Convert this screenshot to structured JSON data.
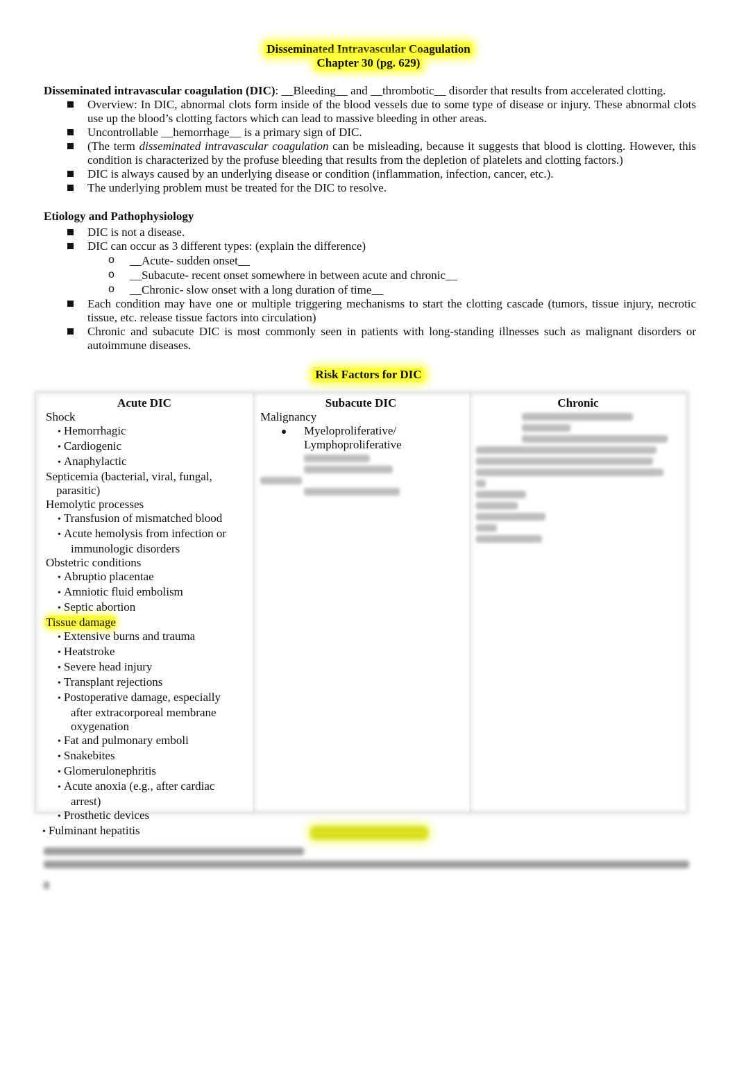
{
  "header": {
    "title": "Disseminated Intravascular Coagulation",
    "subtitle": "Chapter 30 (pg. 629)",
    "highlight_color": "#ffff3a"
  },
  "intro": {
    "term": "Disseminated intravascular coagulation (DIC)",
    "definition": ": __Bleeding__ and __thrombotic__ disorder that results from accelerated clotting.",
    "bullets": [
      {
        "text": "Overview: In DIC, abnormal clots form inside of the blood vessels due to some type of disease or injury. These abnormal clots use up the blood’s clotting factors which can lead to massive bleeding in other areas."
      },
      {
        "text": "Uncontrollable __hemorrhage__ is a primary sign of DIC."
      },
      {
        "pre": "(The term ",
        "em": "disseminated intravascular coagulation",
        "post": " can be misleading, because it suggests that blood is clotting. However, this condition is characterized by the profuse bleeding that results from the depletion of platelets and clotting factors.)"
      },
      {
        "text": "DIC is always caused by an underlying disease or condition (inflammation, infection, cancer, etc.)."
      },
      {
        "text": "The underlying problem must be treated for the DIC to resolve."
      }
    ]
  },
  "etiology": {
    "heading": "Etiology and Pathophysiology",
    "bullets": [
      "DIC is not a disease.",
      "DIC can occur as 3 different types: (explain the difference)"
    ],
    "types": [
      "__Acute- sudden onset__",
      "__Subacute- recent onset somewhere in between acute and chronic__",
      "__Chronic- slow onset with a long duration of time__"
    ],
    "bullets_after": [
      "Each condition may have one or multiple triggering mechanisms to start the clotting cascade (tumors, tissue injury, necrotic tissue, etc. release tissue factors into circulation)",
      "Chronic and subacute DIC is most commonly seen in patients with long-standing illnesses such as malignant disorders or autoimmune diseases."
    ]
  },
  "risk_table": {
    "title": "Risk Factors for DIC",
    "headers": [
      "Acute DIC",
      "Subacute DIC",
      "Chronic"
    ],
    "acute": {
      "shock": {
        "label": "Shock",
        "items": [
          "Hemorrhagic",
          "Cardiogenic",
          "Anaphylactic"
        ]
      },
      "septicemia": {
        "line1": "Septicemia (bacterial, viral, fungal,",
        "line2": "parasitic)"
      },
      "hemolytic": {
        "label": "Hemolytic processes",
        "items": [
          "Transfusion of mismatched blood",
          "Acute hemolysis from infection or"
        ],
        "continuation": "immunologic disorders"
      },
      "obstetric": {
        "label": "Obstetric conditions",
        "items": [
          "Abruptio placentae",
          "Amniotic fluid embolism",
          "Septic abortion"
        ]
      },
      "tissue": {
        "label": "Tissue damage",
        "items": [
          "Extensive burns and trauma",
          "Heatstroke",
          "Severe head injury",
          "Transplant rejections",
          "Postoperative damage, especially"
        ],
        "cont1": "after extracorporeal membrane",
        "cont2": "oxygenation",
        "items2": [
          "Fat and pulmonary emboli",
          "Snakebites",
          "Glomerulonephritis",
          "Acute anoxia (e.g., after cardiac"
        ],
        "cont3": "arrest)",
        "items3": [
          "Prosthetic devices"
        ]
      },
      "last": "Fulminant hepatitis"
    },
    "subacute": {
      "label": "Malignancy",
      "item_line1": "Myeloproliferative/",
      "item_line2": "Lymphoproliferative"
    }
  }
}
